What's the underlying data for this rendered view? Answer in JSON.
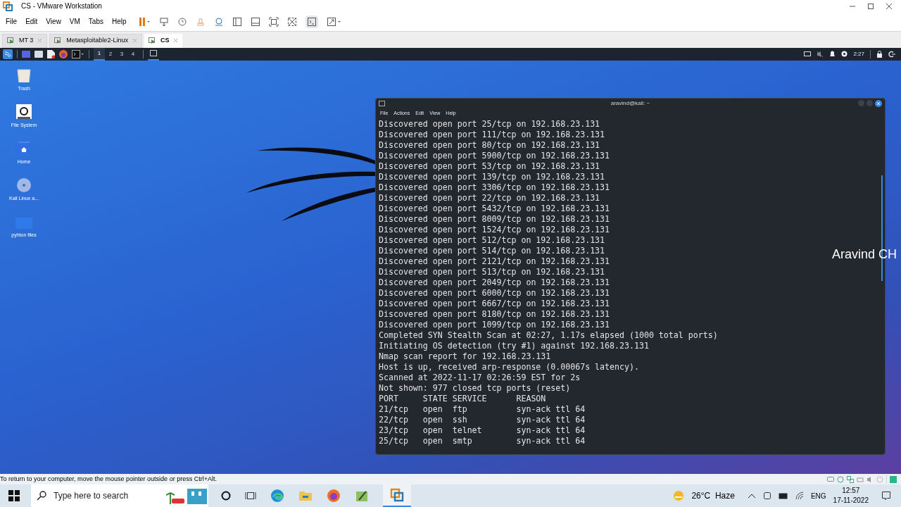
{
  "window": {
    "title": "CS - VMware Workstation"
  },
  "menu": [
    "File",
    "Edit",
    "View",
    "VM",
    "Tabs",
    "Help"
  ],
  "tabs": [
    {
      "label": "MT 3",
      "selected": false
    },
    {
      "label": "Metasploitable2-Linux",
      "selected": false
    },
    {
      "label": "CS",
      "selected": true
    }
  ],
  "guest_panel": {
    "workspaces": [
      {
        "label": "1",
        "selected": true
      },
      {
        "label": "2",
        "selected": false
      },
      {
        "label": "3",
        "selected": false
      },
      {
        "label": "4",
        "selected": false
      }
    ],
    "clock": "2:27"
  },
  "desktop_icons": [
    {
      "kind": "trash",
      "label": "Trash"
    },
    {
      "kind": "drive",
      "label": "File System"
    },
    {
      "kind": "home",
      "label": "Home"
    },
    {
      "kind": "disc",
      "label": "Kali Linux a..."
    },
    {
      "kind": "folder",
      "label": "pyhton files"
    }
  ],
  "terminal": {
    "title": "aravind@kali: ~",
    "menu": [
      "File",
      "Actions",
      "Edit",
      "View",
      "Help"
    ],
    "lines": [
      "Discovered open port 25/tcp on 192.168.23.131",
      "Discovered open port 111/tcp on 192.168.23.131",
      "Discovered open port 80/tcp on 192.168.23.131",
      "Discovered open port 5900/tcp on 192.168.23.131",
      "Discovered open port 53/tcp on 192.168.23.131",
      "Discovered open port 139/tcp on 192.168.23.131",
      "Discovered open port 3306/tcp on 192.168.23.131",
      "Discovered open port 22/tcp on 192.168.23.131",
      "Discovered open port 5432/tcp on 192.168.23.131",
      "Discovered open port 8009/tcp on 192.168.23.131",
      "Discovered open port 1524/tcp on 192.168.23.131",
      "Discovered open port 512/tcp on 192.168.23.131",
      "Discovered open port 514/tcp on 192.168.23.131",
      "Discovered open port 2121/tcp on 192.168.23.131",
      "Discovered open port 513/tcp on 192.168.23.131",
      "Discovered open port 2049/tcp on 192.168.23.131",
      "Discovered open port 6000/tcp on 192.168.23.131",
      "Discovered open port 6667/tcp on 192.168.23.131",
      "Discovered open port 8180/tcp on 192.168.23.131",
      "Discovered open port 1099/tcp on 192.168.23.131",
      "Completed SYN Stealth Scan at 02:27, 1.17s elapsed (1000 total ports)",
      "Initiating OS detection (try #1) against 192.168.23.131",
      "Nmap scan report for 192.168.23.131",
      "Host is up, received arp-response (0.00067s latency).",
      "Scanned at 2022-11-17 02:26:59 EST for 2s",
      "Not shown: 977 closed tcp ports (reset)",
      "PORT     STATE SERVICE      REASON",
      "21/tcp   open  ftp          syn-ack ttl 64",
      "22/tcp   open  ssh          syn-ack ttl 64",
      "23/tcp   open  telnet       syn-ack ttl 64",
      "25/tcp   open  smtp         syn-ack ttl 64"
    ]
  },
  "overlay_caption": "Aravind CH",
  "status_bar": "To return to your computer, move the mouse pointer outside or press Ctrl+Alt.",
  "taskbar": {
    "search": {
      "placeholder": "Type here to search"
    },
    "weather": "26°C  Haze",
    "language": "ENG",
    "time": "12:57",
    "date": "17-11-2022"
  }
}
